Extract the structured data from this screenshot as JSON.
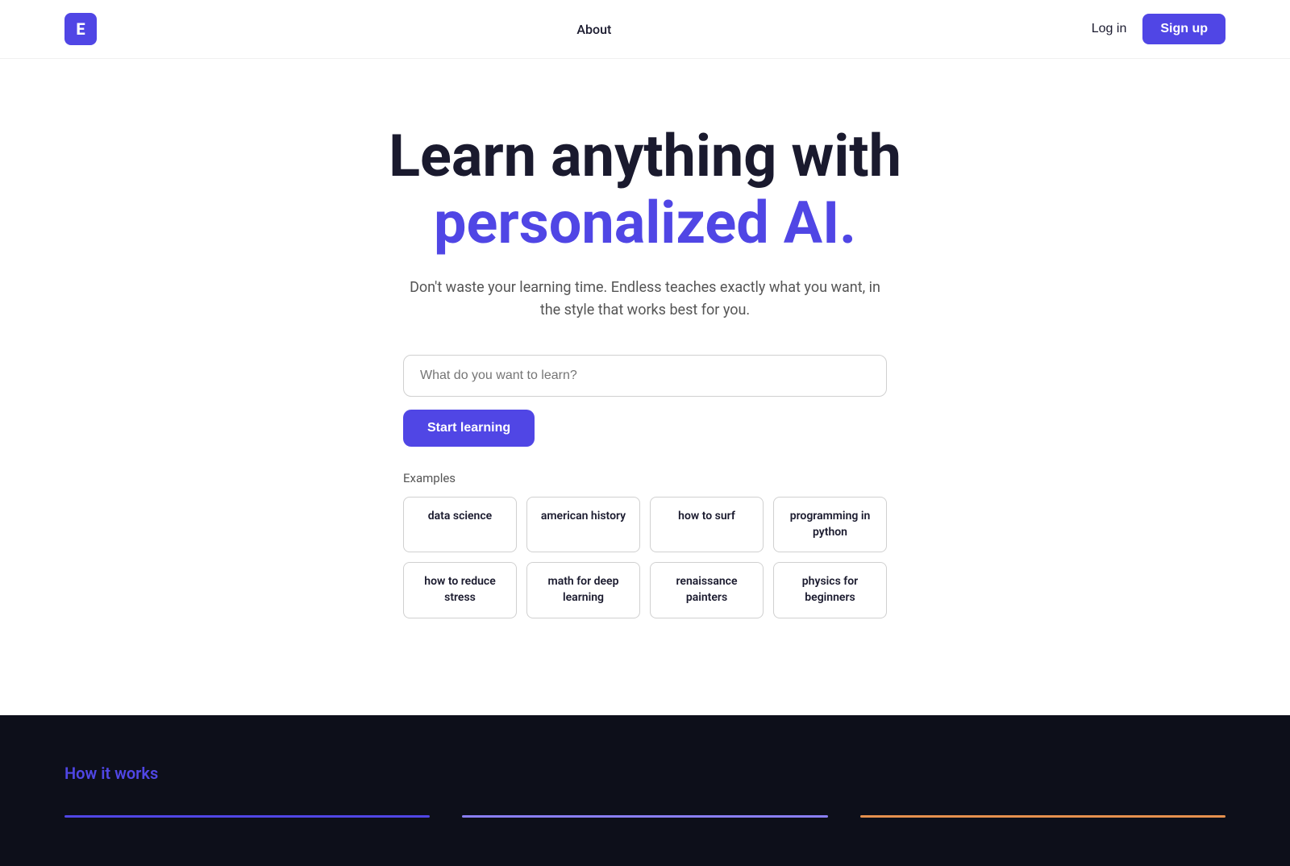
{
  "nav": {
    "logo_letter": "E",
    "links": [
      {
        "label": "About"
      }
    ],
    "login_label": "Log in",
    "signup_label": "Sign up"
  },
  "hero": {
    "title_part1": "Learn anything with",
    "title_accent": "personalized AI.",
    "subtitle": "Don't waste your learning time. Endless teaches exactly what you want, in the style that works best for you.",
    "search_placeholder": "What do you want to learn?",
    "cta_label": "Start learning",
    "examples_label": "Examples",
    "examples": [
      {
        "label": "data science"
      },
      {
        "label": "american history"
      },
      {
        "label": "how to surf"
      },
      {
        "label": "programming in python"
      },
      {
        "label": "how to reduce stress"
      },
      {
        "label": "math for deep learning"
      },
      {
        "label": "renaissance painters"
      },
      {
        "label": "physics for beginners"
      }
    ]
  },
  "dark_section": {
    "how_it_works_label": "How it works"
  },
  "colors": {
    "accent": "#5046e5",
    "dark_bg": "#0d0f1a"
  }
}
